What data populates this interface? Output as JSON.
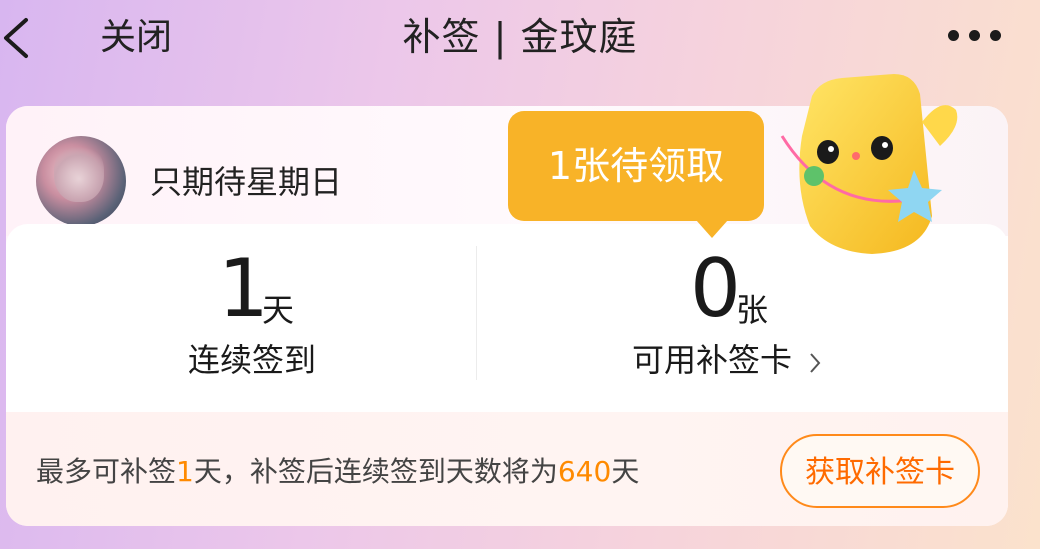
{
  "header": {
    "close_label": "关闭",
    "title": "补签 | 金玟庭"
  },
  "user": {
    "name": "只期待星期日"
  },
  "stats": {
    "streak_value": "1",
    "streak_unit": "天",
    "streak_label": "连续签到",
    "cards_value": "0",
    "cards_unit": "张",
    "cards_label": "可用补签卡"
  },
  "tooltip": {
    "text": "1张待领取"
  },
  "bottom": {
    "text_part1": "最多可补签",
    "text_days": "1",
    "text_part2": "天，补签后连续签到天数将为",
    "text_total": "640",
    "text_part3": "天",
    "button_label": "获取补签卡"
  },
  "icons": {
    "back": "chevron-left-icon",
    "more": "more-dots-icon",
    "chevron": "chevron-right-icon"
  },
  "colors": {
    "accent_orange": "#ff8a00",
    "tooltip_yellow": "#f8b328",
    "text_dark": "#1a1a1a"
  }
}
